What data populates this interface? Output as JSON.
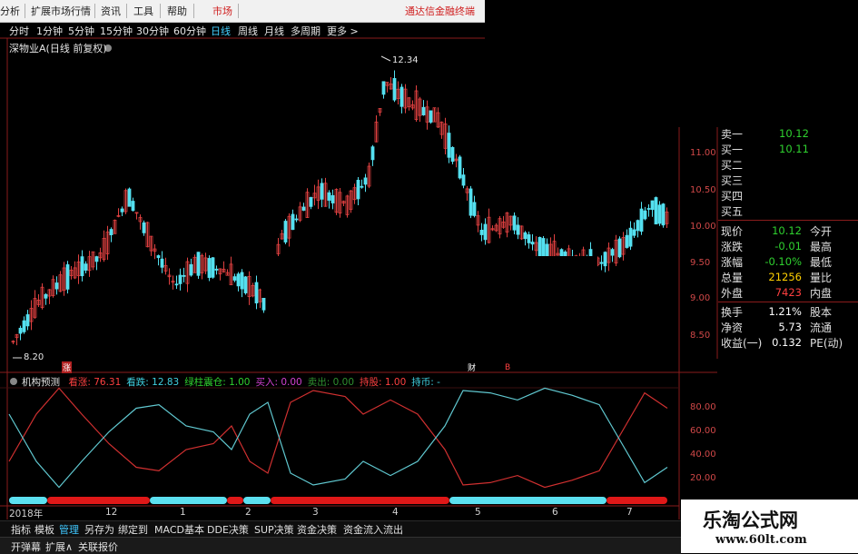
{
  "menu": {
    "items": [
      "分析",
      "扩展市场行情",
      "资讯",
      "工具",
      "帮助"
    ],
    "market": "市场",
    "brand": "通达信金融终端"
  },
  "periods": {
    "items": [
      "分时",
      "1分钟",
      "5分钟",
      "15分钟",
      "30分钟",
      "60分钟",
      "日线",
      "周线",
      "月线",
      "多周期",
      "更多 >"
    ],
    "active": "日线"
  },
  "stock": {
    "title": "深物业A(日线 前复权)",
    "high_label": "12.34",
    "low_label": "8.20",
    "markers": [
      "涨",
      "财",
      "B"
    ]
  },
  "price_axis": [
    "11.00",
    "10.50",
    "10.00",
    "9.50",
    "9.00",
    "8.50"
  ],
  "indicator": {
    "name": "机构预测",
    "fields": [
      {
        "label": "看涨:",
        "value": "76.31",
        "color": "#ff4040"
      },
      {
        "label": "看跌:",
        "value": "12.83",
        "color": "#40d0e0"
      },
      {
        "label": "绿柱震仓:",
        "value": "1.00",
        "color": "#2fd12f"
      },
      {
        "label": "买入:",
        "value": "0.00",
        "color": "#d040d0"
      },
      {
        "label": "卖出:",
        "value": "0.00",
        "color": "#2f8f2f"
      },
      {
        "label": "持股:",
        "value": "1.00",
        "color": "#ff4040"
      },
      {
        "label": "持币:",
        "value": "-",
        "color": "#40d0e0"
      }
    ],
    "axis": [
      "80.00",
      "60.00",
      "40.00",
      "20.00"
    ]
  },
  "xaxis": [
    "2018年",
    "12",
    "1",
    "2",
    "3",
    "4",
    "5",
    "6",
    "7"
  ],
  "quote": {
    "orders": [
      {
        "label": "卖一",
        "price": "10.12"
      },
      {
        "label": "买一",
        "price": "10.11"
      },
      {
        "label": "买二",
        "price": ""
      },
      {
        "label": "买三",
        "price": ""
      },
      {
        "label": "买四",
        "price": ""
      },
      {
        "label": "买五",
        "price": ""
      }
    ],
    "stats": [
      {
        "l1": "现价",
        "v1": "10.12",
        "c1": "green",
        "l2": "今开"
      },
      {
        "l1": "涨跌",
        "v1": "-0.01",
        "c1": "green",
        "l2": "最高"
      },
      {
        "l1": "涨幅",
        "v1": "-0.10%",
        "c1": "green",
        "l2": "最低"
      },
      {
        "l1": "总量",
        "v1": "21256",
        "c1": "yellow",
        "l2": "量比"
      },
      {
        "l1": "外盘",
        "v1": "7423",
        "c1": "red",
        "l2": "内盘"
      }
    ],
    "finance": [
      {
        "l1": "换手",
        "v1": "1.21%",
        "l2": "股本"
      },
      {
        "l1": "净资",
        "v1": "5.73",
        "l2": "流通"
      },
      {
        "l1": "收益(一)",
        "v1": "0.132",
        "l2": "PE(动)"
      }
    ]
  },
  "bottom_tabs": {
    "items": [
      "指标",
      "模板",
      "管理",
      "另存为",
      "绑定到",
      "MACD基本",
      "DDE决策",
      "SUP决策",
      "资金决策",
      "资金流入流出"
    ],
    "active": "管理"
  },
  "status": [
    "开弹幕",
    "扩展∧",
    "关联报价"
  ],
  "watermark": {
    "name": "乐淘公式网",
    "url": "www.60lt.com"
  }
}
